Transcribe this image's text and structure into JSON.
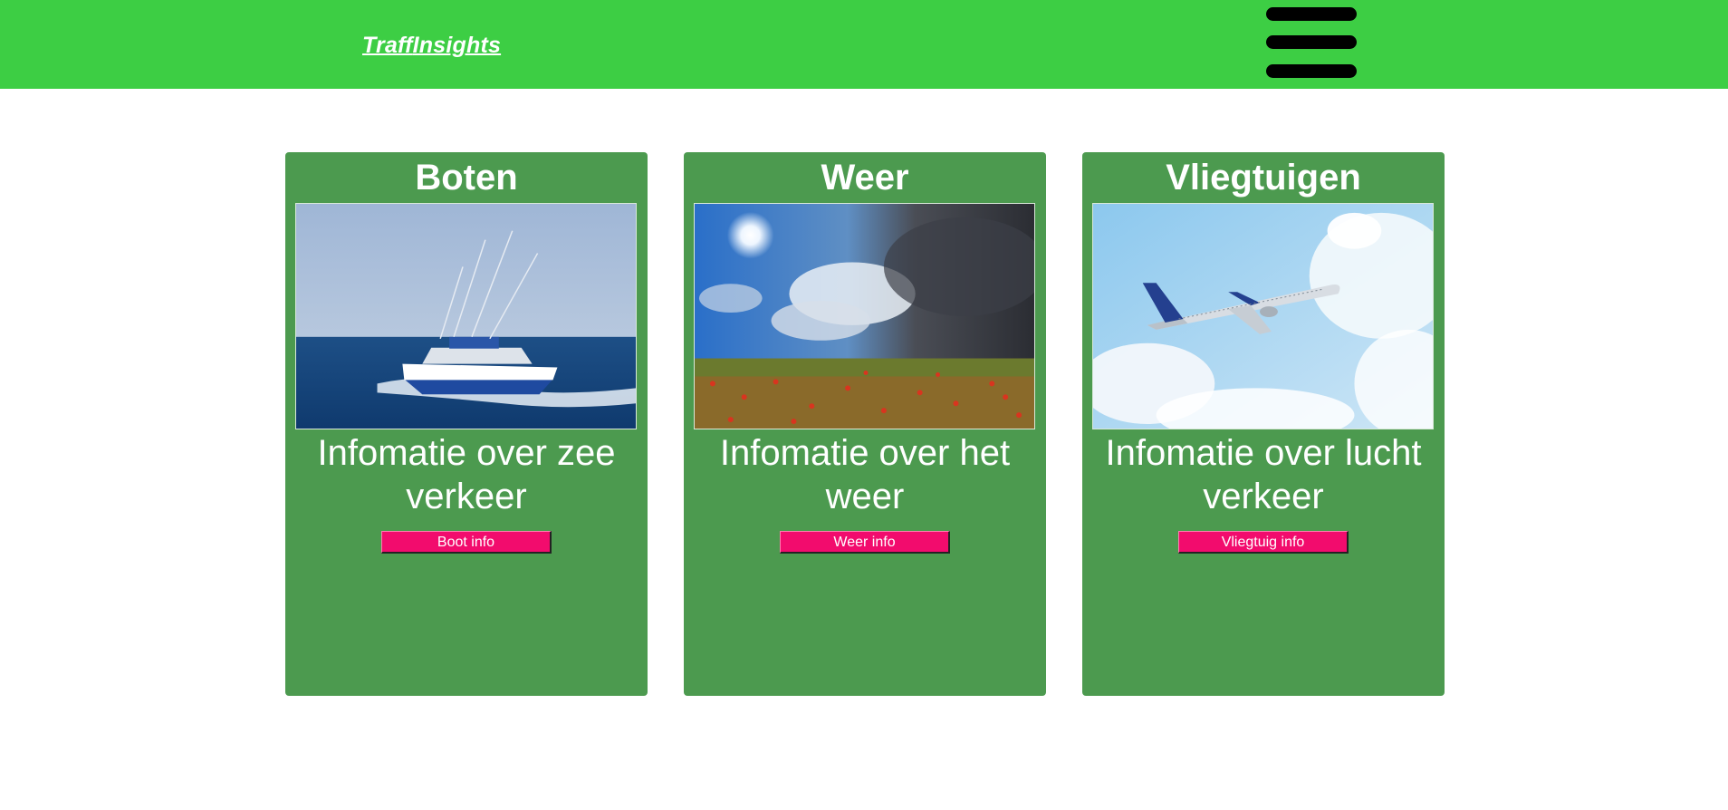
{
  "header": {
    "logo_text_plain": "Traff",
    "logo_text_italic": "Insights",
    "menu_icon": "hamburger-menu-icon",
    "background_color": "#3dce44"
  },
  "cards": [
    {
      "title": "Boten",
      "image": "motorboat-at-sea-photo",
      "description": "Infomatie over zee verkeer",
      "button_label": "Boot info"
    },
    {
      "title": "Weer",
      "image": "stormy-sky-poppy-field-photo",
      "description": "Infomatie over het weer",
      "button_label": "Weer info"
    },
    {
      "title": "Vliegtuigen",
      "image": "airplane-in-sky-photo",
      "description": "Infomatie over lucht verkeer",
      "button_label": "Vliegtuig info"
    }
  ],
  "colors": {
    "card_background": "#4c9a4f",
    "button_background": "#f20c6d",
    "text": "#ffffff"
  }
}
